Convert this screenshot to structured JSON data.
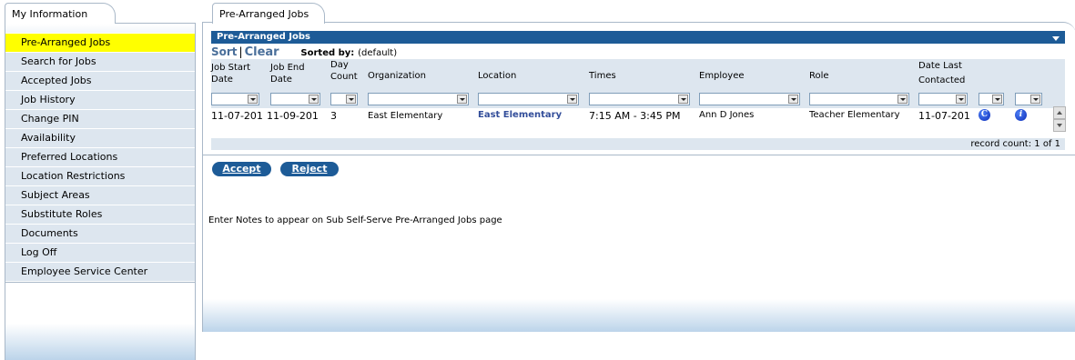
{
  "left_tab": {
    "label": "My Information"
  },
  "nav": [
    {
      "label": "Pre-Arranged Jobs",
      "active": true
    },
    {
      "label": "Search for Jobs"
    },
    {
      "label": "Accepted Jobs"
    },
    {
      "label": "Job History"
    },
    {
      "label": "Change PIN"
    },
    {
      "label": "Availability"
    },
    {
      "label": "Preferred Locations"
    },
    {
      "label": "Location Restrictions"
    },
    {
      "label": "Subject Areas"
    },
    {
      "label": "Substitute Roles"
    },
    {
      "label": "Documents"
    },
    {
      "label": "Log Off"
    },
    {
      "label": "Employee Service Center"
    }
  ],
  "main_tab": {
    "label": "Pre-Arranged Jobs"
  },
  "grid": {
    "title": "Pre-Arranged Jobs",
    "sort_label": "Sort",
    "sort_sep": "|",
    "clear_label": "Clear",
    "sorted_by_label": "Sorted by:",
    "sorted_by_value": "(default)",
    "columns": {
      "job_start": "Job Start Date",
      "job_end": "Job End Date",
      "day_count": "Day Count",
      "organization": "Organization",
      "location": "Location",
      "times": "Times",
      "employee": "Employee",
      "role": "Role",
      "date_last_contacted": "Date Last Contacted"
    },
    "row": {
      "job_start": "11-07-201",
      "job_end": "11-09-201",
      "day_count": "3",
      "organization": "East Elementary",
      "location": "East Elementary",
      "times": "7:15 AM - 3:45 PM",
      "employee": "Ann D Jones",
      "role": "Teacher Elementary",
      "date_last_contacted": "11-07-201",
      "icon_c": "C",
      "icon_i": "i"
    },
    "record_count": "record count: 1 of 1"
  },
  "buttons": {
    "accept": "Accept",
    "reject": "Reject"
  },
  "notes": "Enter Notes to appear on Sub Self-Serve Pre-Arranged Jobs page",
  "colors": {
    "header_blue": "#1d5b97",
    "active_nav": "#ffff00",
    "nav_bg": "#dde6ef",
    "link": "#334e9a"
  }
}
